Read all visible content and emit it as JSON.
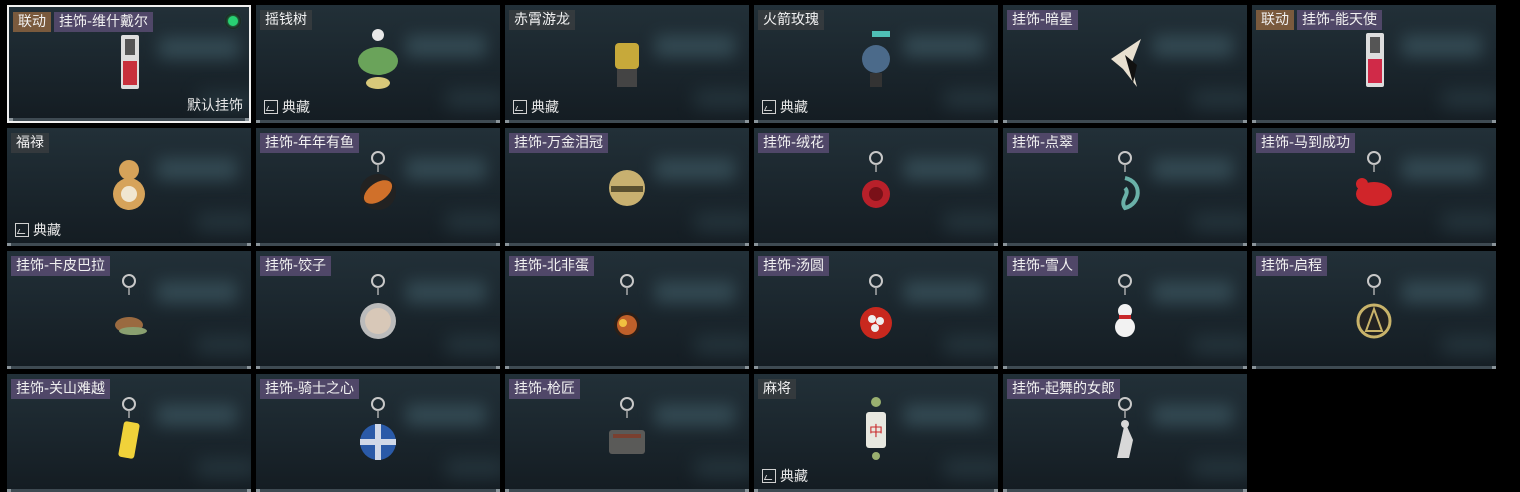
{
  "colors": {
    "selected_border": "#f0f0f0",
    "equipped_dot": "#28d072",
    "collab_tag": "#7a5a3d",
    "name_tag": "#60507a"
  },
  "items": [
    {
      "badge": "联动",
      "name": "挂饰-维什戴尔",
      "selected": true,
      "equipped": true,
      "default_label": "默认挂饰",
      "icon": "luggage-tag-icon",
      "color": "#c8303c"
    },
    {
      "name": "摇钱树",
      "classic": "典藏",
      "icon": "money-tree-icon",
      "color": "#6aa35a",
      "plain": true
    },
    {
      "name": "赤霄游龙",
      "classic": "典藏",
      "icon": "dragon-figure-icon",
      "color": "#c7a93a",
      "plain": true
    },
    {
      "name": "火箭玫瑰",
      "classic": "典藏",
      "icon": "rocket-figure-icon",
      "color": "#4b6a8a",
      "plain": true
    },
    {
      "name": "挂饰-暗星",
      "icon": "dark-star-icon",
      "color": "#e8e0d0"
    },
    {
      "badge": "联动",
      "name": "挂饰-能天使",
      "icon": "luggage-tag-icon",
      "color": "#d02a48"
    },
    {
      "name": "福禄",
      "classic": "典藏",
      "icon": "gourd-icon",
      "color": "#d6a35a",
      "plain": true
    },
    {
      "name": "挂饰-年年有鱼",
      "icon": "fish-plate-icon",
      "color": "#d0702a"
    },
    {
      "name": "挂饰-万金泪冠",
      "icon": "crown-emblem-icon",
      "color": "#c8b070"
    },
    {
      "name": "挂饰-绒花",
      "icon": "rose-icon",
      "color": "#b8202a"
    },
    {
      "name": "挂饰-点翠",
      "icon": "phoenix-pin-icon",
      "color": "#6ab0a8"
    },
    {
      "name": "挂饰-马到成功",
      "icon": "red-horse-icon",
      "color": "#d0252a"
    },
    {
      "name": "挂饰-卡皮巴拉",
      "icon": "capybara-icon",
      "color": "#9a6a40"
    },
    {
      "name": "挂饰-饺子",
      "icon": "dumpling-plate-icon",
      "color": "#d8c8b8"
    },
    {
      "name": "挂饰-北非蛋",
      "icon": "shakshuka-icon",
      "color": "#c0602a"
    },
    {
      "name": "挂饰-汤圆",
      "icon": "tangyuan-bowl-icon",
      "color": "#c8281e"
    },
    {
      "name": "挂饰-雪人",
      "icon": "snowman-icon",
      "color": "#f2f2f2"
    },
    {
      "name": "挂饰-启程",
      "icon": "compass-ring-icon",
      "color": "#c8b36a"
    },
    {
      "name": "挂饰-关山难越",
      "icon": "yellow-cylinder-icon",
      "color": "#f0d23a"
    },
    {
      "name": "挂饰-骑士之心",
      "icon": "knight-cross-icon",
      "color": "#2a5aa8"
    },
    {
      "name": "挂饰-枪匠",
      "icon": "gun-case-icon",
      "color": "#5a5a58"
    },
    {
      "name": "麻将",
      "classic": "典藏",
      "icon": "mahjong-tile-icon",
      "color": "#e8e8e0",
      "plain": true
    },
    {
      "name": "挂饰-起舞的女郎",
      "icon": "dancer-statue-icon",
      "color": "#d8d8d8"
    }
  ]
}
